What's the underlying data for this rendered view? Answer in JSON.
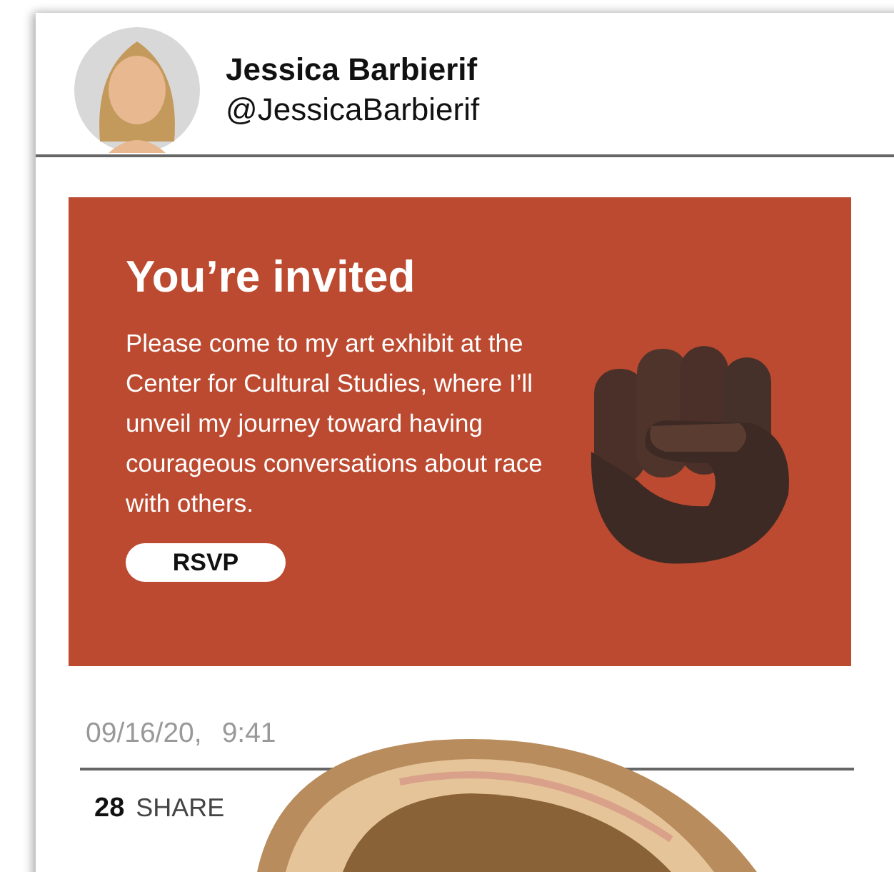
{
  "profile": {
    "name": "Jessica Barbierif",
    "handle": "@JessicaBarbierif"
  },
  "invite": {
    "title": "You’re invited",
    "body": "Please come to my art exhibit at the Center for Cultural Studies, where I’ll unveil my journey toward having courageous conversations about race with others.",
    "button": "RSVP"
  },
  "meta": {
    "date": "09/16/20,",
    "time": "9:41"
  },
  "stats": {
    "count": "28",
    "label": "SHARE"
  }
}
